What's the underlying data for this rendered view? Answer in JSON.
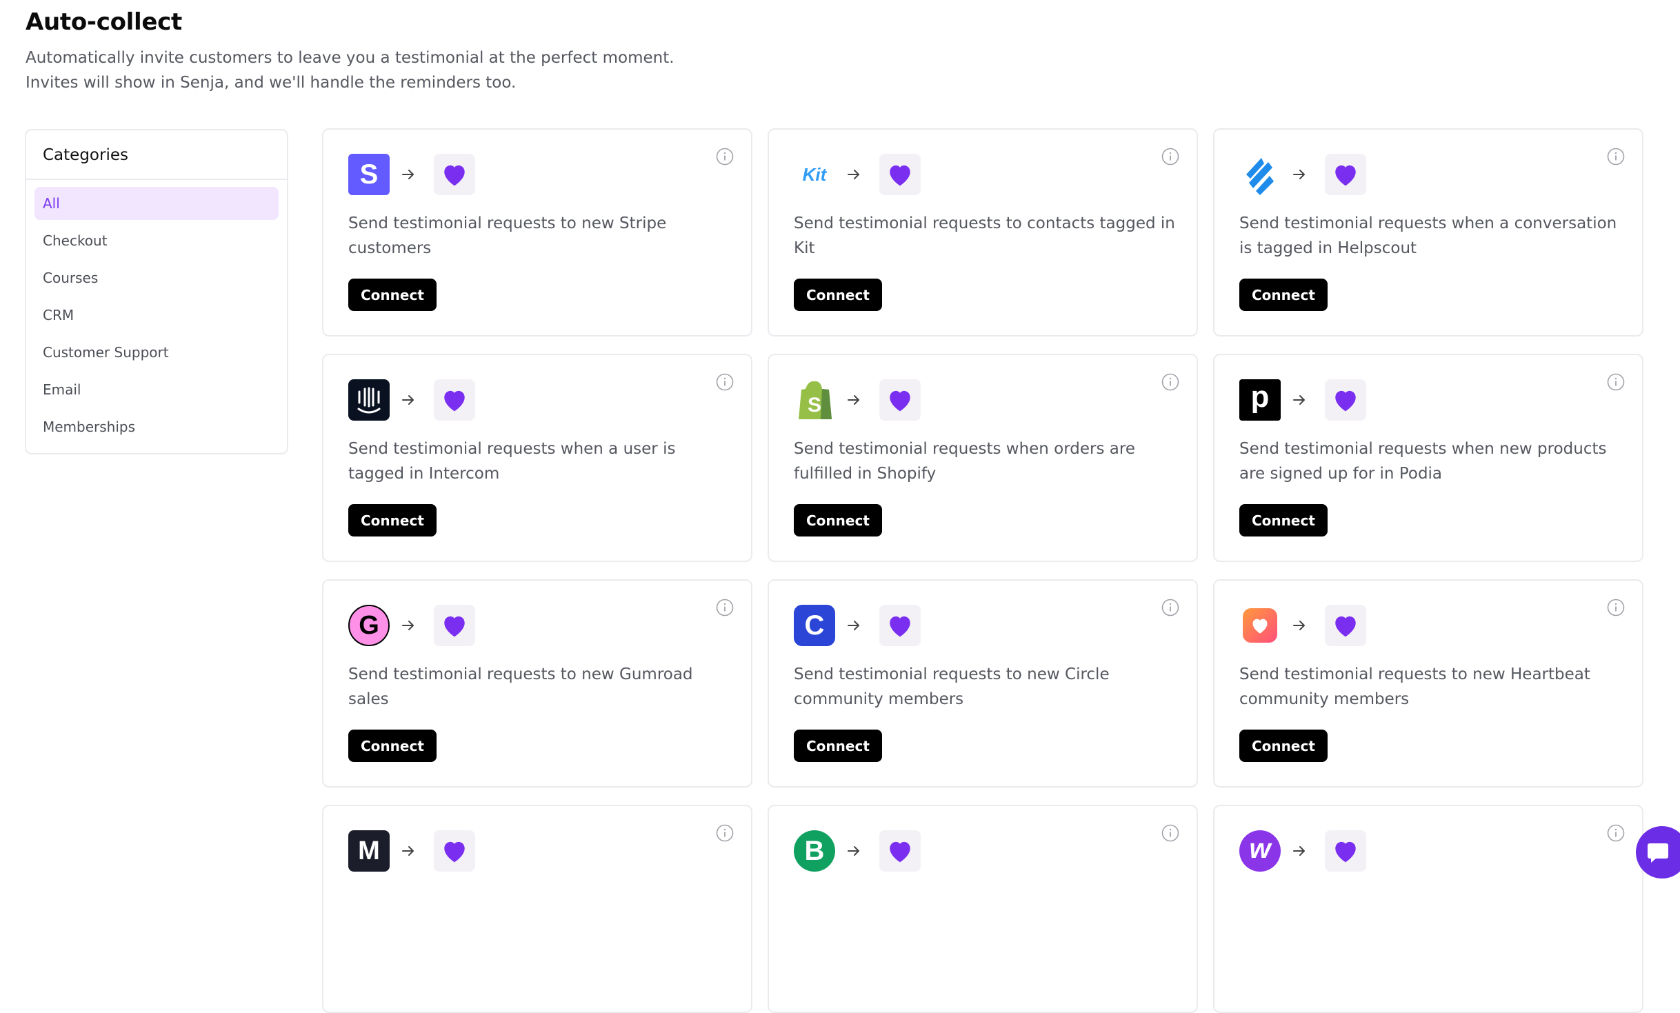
{
  "page": {
    "title": "Auto-collect",
    "description": "Automatically invite customers to leave you a testimonial at the perfect moment. Invites will show in Senja, and we'll handle the reminders too."
  },
  "sidebar": {
    "title": "Categories",
    "items": [
      {
        "label": "All",
        "active": true
      },
      {
        "label": "Checkout"
      },
      {
        "label": "Courses"
      },
      {
        "label": "CRM"
      },
      {
        "label": "Customer Support"
      },
      {
        "label": "Email"
      },
      {
        "label": "Memberships"
      }
    ]
  },
  "cards": [
    {
      "logo": "stripe-logo",
      "logo_text": "S",
      "description": "Send testimonial requests to new Stripe customers",
      "button": "Connect"
    },
    {
      "logo": "kit-logo",
      "logo_text": "Kit",
      "description": "Send testimonial requests to contacts tagged in Kit",
      "button": "Connect"
    },
    {
      "logo": "helpscout-logo",
      "description": "Send testimonial requests when a conversation is tagged in Helpscout",
      "button": "Connect"
    },
    {
      "logo": "intercom-logo",
      "description": "Send testimonial requests when a user is tagged in Intercom",
      "button": "Connect"
    },
    {
      "logo": "shopify-logo",
      "logo_text": "S",
      "description": "Send testimonial requests when orders are fulfilled in Shopify",
      "button": "Connect"
    },
    {
      "logo": "podia-logo",
      "logo_text": "p",
      "description": "Send testimonial requests when new products are signed up for in Podia",
      "button": "Connect"
    },
    {
      "logo": "gumroad-logo",
      "logo_text": "G",
      "description": "Send testimonial requests to new Gumroad sales",
      "button": "Connect"
    },
    {
      "logo": "circle-logo",
      "logo_text": "C",
      "description": "Send testimonial requests to new Circle community members",
      "button": "Connect"
    },
    {
      "logo": "heartbeat-logo",
      "description": "Send testimonial requests to new Heartbeat community members",
      "button": "Connect"
    },
    {
      "logo": "m-logo",
      "logo_text": "M",
      "description": "",
      "button": ""
    },
    {
      "logo": "b-logo",
      "logo_text": "B",
      "description": "",
      "button": ""
    },
    {
      "logo": "w-logo",
      "logo_text": "w",
      "description": "",
      "button": ""
    }
  ],
  "icons": {
    "arrow": "arrow-right-icon",
    "target": "heart-icon",
    "info": "info-icon",
    "chat": "chat-icon"
  },
  "colors": {
    "accent": "#7c3aed",
    "heart": "#7a2ff0",
    "active_bg": "#f1e6fd",
    "button_bg": "#000000"
  }
}
